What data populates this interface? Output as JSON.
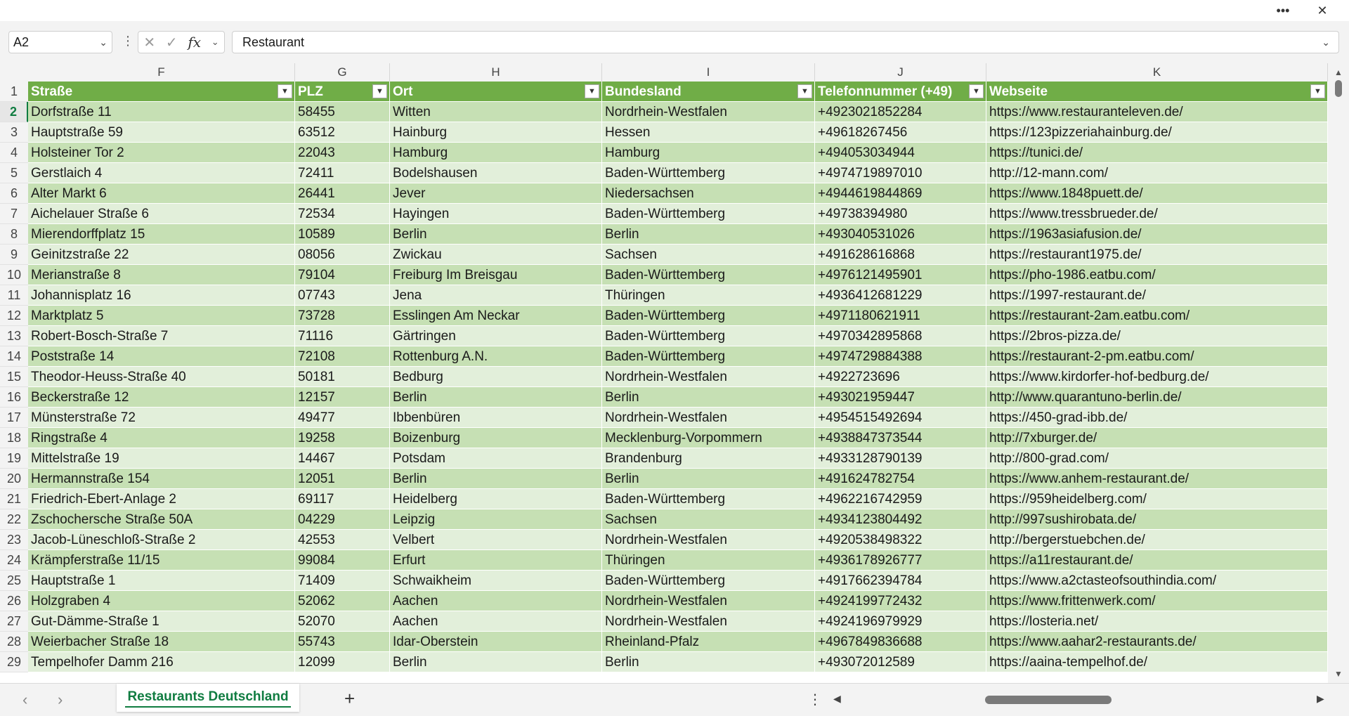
{
  "window": {
    "more_icon": "more-horizontal-icon",
    "close_icon": "close-icon"
  },
  "formula_bar": {
    "name_box": "A2",
    "value": "Restaurant",
    "fx_label": "fx"
  },
  "columns": [
    "F",
    "G",
    "H",
    "I",
    "J",
    "K"
  ],
  "header_row_number": "1",
  "table_headers": [
    "Straße",
    "PLZ",
    "Ort",
    "Bundesland",
    "Telefonnummer (+49)",
    "Webseite"
  ],
  "rows": [
    {
      "n": "2",
      "cells": [
        "Dorfstraße 11",
        "58455",
        "Witten",
        "Nordrhein-Westfalen",
        "+4923021852284",
        "https://www.restauranteleven.de/"
      ]
    },
    {
      "n": "3",
      "cells": [
        "Hauptstraße 59",
        "63512",
        "Hainburg",
        "Hessen",
        "+49618267456",
        "https://123pizzeriahainburg.de/"
      ]
    },
    {
      "n": "4",
      "cells": [
        "Holsteiner Tor 2",
        "22043",
        "Hamburg",
        "Hamburg",
        "+494053034944",
        "https://tunici.de/"
      ]
    },
    {
      "n": "5",
      "cells": [
        "Gerstlaich 4",
        "72411",
        "Bodelshausen",
        "Baden-Württemberg",
        "+4974719897010",
        "http://12-mann.com/"
      ]
    },
    {
      "n": "6",
      "cells": [
        "Alter Markt 6",
        "26441",
        "Jever",
        "Niedersachsen",
        "+4944619844869",
        "https://www.1848puett.de/"
      ]
    },
    {
      "n": "7",
      "cells": [
        "Aichelauer Straße 6",
        "72534",
        "Hayingen",
        "Baden-Württemberg",
        "+49738394980",
        "https://www.tressbrueder.de/"
      ]
    },
    {
      "n": "8",
      "cells": [
        "Mierendorffplatz 15",
        "10589",
        "Berlin",
        "Berlin",
        "+493040531026",
        "https://1963asiafusion.de/"
      ]
    },
    {
      "n": "9",
      "cells": [
        "Geinitzstraße 22",
        "08056",
        "Zwickau",
        "Sachsen",
        "+491628616868",
        "https://restaurant1975.de/"
      ]
    },
    {
      "n": "10",
      "cells": [
        "Merianstraße 8",
        "79104",
        "Freiburg Im Breisgau",
        "Baden-Württemberg",
        "+4976121495901",
        "https://pho-1986.eatbu.com/"
      ]
    },
    {
      "n": "11",
      "cells": [
        "Johannisplatz 16",
        "07743",
        "Jena",
        "Thüringen",
        "+4936412681229",
        "https://1997-restaurant.de/"
      ]
    },
    {
      "n": "12",
      "cells": [
        "Marktplatz 5",
        "73728",
        "Esslingen Am Neckar",
        "Baden-Württemberg",
        "+4971180621911",
        "https://restaurant-2am.eatbu.com/"
      ]
    },
    {
      "n": "13",
      "cells": [
        "Robert-Bosch-Straße 7",
        "71116",
        "Gärtringen",
        "Baden-Württemberg",
        "+4970342895868",
        "https://2bros-pizza.de/"
      ]
    },
    {
      "n": "14",
      "cells": [
        "Poststraße 14",
        "72108",
        "Rottenburg A.N.",
        "Baden-Württemberg",
        "+4974729884388",
        "https://restaurant-2-pm.eatbu.com/"
      ]
    },
    {
      "n": "15",
      "cells": [
        "Theodor-Heuss-Straße 40",
        "50181",
        "Bedburg",
        "Nordrhein-Westfalen",
        "+4922723696",
        "https://www.kirdorfer-hof-bedburg.de/"
      ]
    },
    {
      "n": "16",
      "cells": [
        "Beckerstraße 12",
        "12157",
        "Berlin",
        "Berlin",
        "+493021959447",
        "http://www.quarantuno-berlin.de/"
      ]
    },
    {
      "n": "17",
      "cells": [
        "Münsterstraße 72",
        "49477",
        "Ibbenbüren",
        "Nordrhein-Westfalen",
        "+4954515492694",
        "https://450-grad-ibb.de/"
      ]
    },
    {
      "n": "18",
      "cells": [
        "Ringstraße 4",
        "19258",
        "Boizenburg",
        "Mecklenburg-Vorpommern",
        "+4938847373544",
        "http://7xburger.de/"
      ]
    },
    {
      "n": "19",
      "cells": [
        "Mittelstraße 19",
        "14467",
        "Potsdam",
        "Brandenburg",
        "+4933128790139",
        "http://800-grad.com/"
      ]
    },
    {
      "n": "20",
      "cells": [
        "Hermannstraße 154",
        "12051",
        "Berlin",
        "Berlin",
        "+491624782754",
        "https://www.anhem-restaurant.de/"
      ]
    },
    {
      "n": "21",
      "cells": [
        "Friedrich-Ebert-Anlage 2",
        "69117",
        "Heidelberg",
        "Baden-Württemberg",
        "+4962216742959",
        "https://959heidelberg.com/"
      ]
    },
    {
      "n": "22",
      "cells": [
        "Zschochersche Straße 50A",
        "04229",
        "Leipzig",
        "Sachsen",
        "+4934123804492",
        "http://997sushirobata.de/"
      ]
    },
    {
      "n": "23",
      "cells": [
        "Jacob-Lüneschloß-Straße 2",
        "42553",
        "Velbert",
        "Nordrhein-Westfalen",
        "+4920538498322",
        "http://bergerstuebchen.de/"
      ]
    },
    {
      "n": "24",
      "cells": [
        "Krämpferstraße 11/15",
        "99084",
        "Erfurt",
        "Thüringen",
        "+4936178926777",
        "https://a11restaurant.de/"
      ]
    },
    {
      "n": "25",
      "cells": [
        "Hauptstraße 1",
        "71409",
        "Schwaikheim",
        "Baden-Württemberg",
        "+4917662394784",
        "https://www.a2ctasteofsouthindia.com/"
      ]
    },
    {
      "n": "26",
      "cells": [
        "Holzgraben 4",
        "52062",
        "Aachen",
        "Nordrhein-Westfalen",
        "+4924199772432",
        "https://www.frittenwerk.com/"
      ]
    },
    {
      "n": "27",
      "cells": [
        "Gut-Dämme-Straße 1",
        "52070",
        "Aachen",
        "Nordrhein-Westfalen",
        "+4924196979929",
        "https://losteria.net/"
      ]
    },
    {
      "n": "28",
      "cells": [
        "Weierbacher Straße 18",
        "55743",
        "Idar-Oberstein",
        "Rheinland-Pfalz",
        "+4967849836688",
        "https://www.aahar2-restaurants.de/"
      ]
    },
    {
      "n": "29",
      "cells": [
        "Tempelhofer Damm 216",
        "12099",
        "Berlin",
        "Berlin",
        "+493072012589",
        "https://aaina-tempelhof.de/"
      ]
    }
  ],
  "sheet_tabs": [
    {
      "label": "Restaurants Deutschland",
      "active": true
    }
  ],
  "colors": {
    "header_fill": "#70ad47",
    "band_dark": "#c6e0b4",
    "band_light": "#e2efda",
    "accent": "#107c41"
  }
}
